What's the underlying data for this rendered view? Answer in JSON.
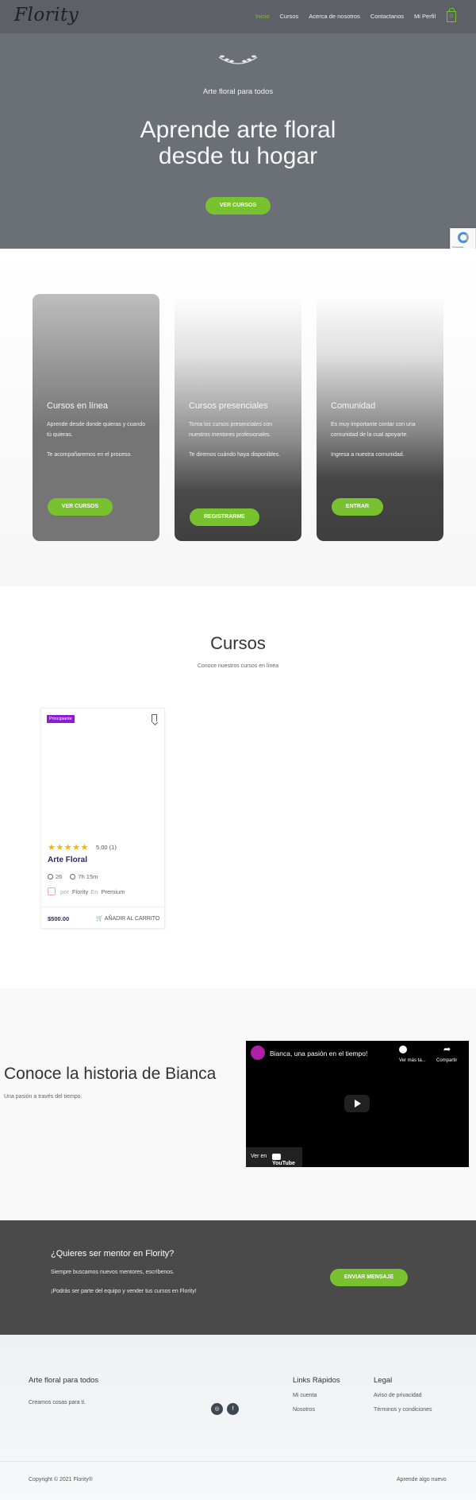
{
  "header": {
    "logo": "Flority",
    "nav": [
      "Inicio",
      "Cursos",
      "Acerca de nosotros",
      "Contactanos",
      "Mi Perfil"
    ],
    "cart_count": "0"
  },
  "hero": {
    "tagline": "Arte floral para todos",
    "title": "Aprende arte floral desde tu hogar",
    "button": "VER CURSOS"
  },
  "cards": [
    {
      "title": "Cursos en línea",
      "paragraphs": [
        "Aprende desde donde quieras y cuando tú quieras.",
        "Te acompañaremos en el proceso."
      ],
      "button": "VER CURSOS"
    },
    {
      "title": "Cursos presenciales",
      "paragraphs": [
        "Toma los cursos presenciales con nuestros mentores profesionales.",
        "Te diremos cuándo haya disponibles."
      ],
      "button": "REGISTRARME"
    },
    {
      "title": "Comunidad",
      "paragraphs": [
        "Es muy importante contar con una comunidad de la cual apoyarte.",
        "Ingresa a nuestra comunidad."
      ],
      "button": "ENTRAR"
    }
  ],
  "courses": {
    "title": "Cursos",
    "subtitle": "Conoce nuestros cursos en línea",
    "items": [
      {
        "level": "Principiante",
        "stars": "★★★★★",
        "rating": "5.00 (1)",
        "name": "Arte Floral",
        "students": "26",
        "duration": "7h 15m",
        "by": "por",
        "author": "Flority",
        "in": "En",
        "category": "Premium",
        "price": "$500.00",
        "add_to_cart": "AÑADIR AL CARRITO"
      }
    ]
  },
  "story": {
    "title": "Conoce la historia de Bianca",
    "subtitle": "Una pasión a través del tiempo.",
    "video": {
      "title": "Bianca, una pasión en el tiempo!",
      "watch_later": "Ver más ta...",
      "share": "Compartir",
      "watch_on": "Ver en",
      "youtube": "YouTube"
    }
  },
  "mentor": {
    "title": "¿Quieres ser mentor en Flority?",
    "p1": "Siempre buscamos nuevos mentores, escríbenos.",
    "p2": "¡Podrás ser parte del equipo y vender tus cursos en Flority!",
    "button": "ENVIAR MENSAJE"
  },
  "footer": {
    "brand_title": "Arte floral para todos",
    "brand_text": "Creamos cosas para ti.",
    "social": [
      "instagram",
      "facebook"
    ],
    "quick_links_title": "Links Rápidos",
    "quick_links": [
      "Mi cuenta",
      "Nosotros"
    ],
    "legal_title": "Legal",
    "legal_links": [
      "Aviso de privacidad",
      "Términos y condiciones"
    ],
    "copyright": "Copyright © 2021 Flority®",
    "slogan": "Aprende algo nuevo"
  },
  "colors": {
    "accent": "#78c12f",
    "hero_bg": "#6b6f76",
    "mentor_bg": "#4a4a4a",
    "badge": "#8e19d6"
  }
}
